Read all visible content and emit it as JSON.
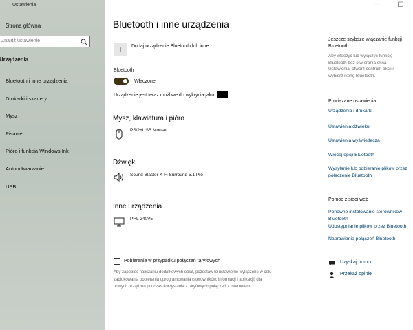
{
  "app_title": "Ustawienia",
  "window_controls": {
    "minimize": "—",
    "maximize": "☐"
  },
  "sidebar": {
    "home": "Strona główna",
    "search_placeholder": "Znajdź ustawienie",
    "section": "Urządzenia",
    "items": [
      {
        "label": "Bluetooth i inne urządzenia"
      },
      {
        "label": "Drukarki i skanery"
      },
      {
        "label": "Mysz"
      },
      {
        "label": "Pisanie"
      },
      {
        "label": "Pióro i funkcja Windows Ink"
      },
      {
        "label": "Autoodtwarzanie"
      },
      {
        "label": "USB"
      }
    ]
  },
  "main": {
    "title": "Bluetooth i inne urządzenia",
    "add_device": "Dodaj urządzenie Bluetooth lub inne",
    "bluetooth_label": "Bluetooth",
    "bluetooth_state": "Włączone",
    "discoverable_text": "Urządzenie jest teraz możliwe do wykrycia jako",
    "groups": {
      "mouse": {
        "title": "Mysz, klawiatura i pióro",
        "device": "PS/2+USB Mouse"
      },
      "audio": {
        "title": "Dźwięk",
        "device": "Sound Blaster X-Fi Surround 5.1 Pro"
      },
      "other": {
        "title": "Inne urządzenia",
        "device": "PHL 240V5"
      }
    },
    "metered_label": "Pobieranie w przypadku połączeń taryfowych",
    "metered_desc": "Aby zapobiec naliczaniu dodatkowych opłat, pozostaw to ustawienie wyłączone w celu zablokowania pobierania oprogramowania (sterowników, informacji i aplikacji) dla nowych urządzeń podczas korzystania z taryfowych połączeń z Internetem."
  },
  "right_panel": {
    "faster_title": "Jeszcze szybsze włączanie funkcji Bluetooth",
    "faster_desc": "Aby włączyć lub wyłączyć funkcję Bluetooth bez otwierania okna Ustawienia, otwórz centrum akcji i wybierz ikonę Bluetooth.",
    "related_title": "Powiązane ustawienia",
    "related_links": [
      "Urządzenia i drukarki",
      "Ustawienia dźwięku",
      "Ustawienia wyświetlacza",
      "Więcej opcji Bluetooth",
      "Wysyłanie lub odbieranie plików przez połączenie Bluetooth"
    ],
    "help_title": "Pomoc z sieci web",
    "help_links": [
      "Ponowne instalowanie sterowników Bluetooth",
      "Udostępnianie plików przez Bluetooth",
      "Naprawianie połączeń Bluetooth"
    ],
    "get_help": "Uzyskaj pomoc",
    "feedback": "Przekaż opinię"
  }
}
